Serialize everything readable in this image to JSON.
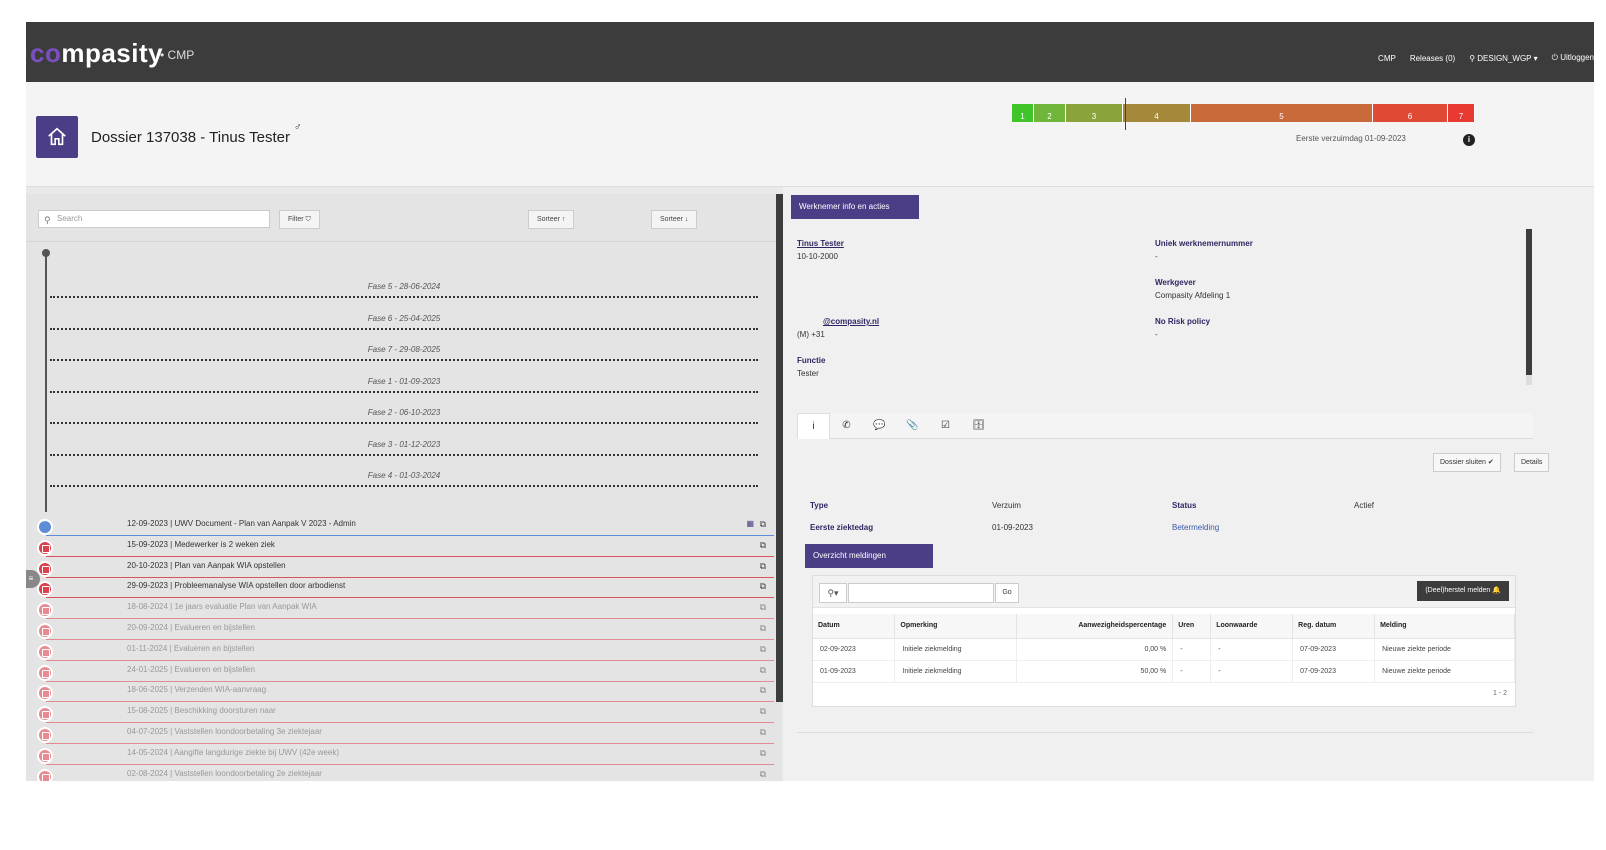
{
  "app": {
    "logo_prefix": "co",
    "logo_rest": "mpasity",
    "logo_sub": "• CMP",
    "nav": {
      "cmp": "CMP",
      "releases": "Releases (0)",
      "user": "DESIGN_WGP",
      "logout": "Uitloggen"
    }
  },
  "header": {
    "title": "Dossier 137038 - Tinus Tester",
    "gender_symbol": "♂",
    "first_absence": "Eerste verzuimdag 01-09-2023",
    "info": "i",
    "phases": [
      {
        "label": "1",
        "color": "#3fc52a"
      },
      {
        "label": "2",
        "color": "#6fb63a"
      },
      {
        "label": "3",
        "color": "#8aa33a"
      },
      {
        "label": "4",
        "color": "#a5893a"
      },
      {
        "label": "5",
        "color": "#c96a3a"
      },
      {
        "label": "6",
        "color": "#e04a34"
      },
      {
        "label": "7",
        "color": "#e83a30"
      }
    ]
  },
  "left": {
    "search_placeholder": "Search",
    "filter_label": "Filter",
    "sort_up_label": "Sorteer ↑",
    "sort_down_label": "Sorteer ↓",
    "phases": [
      "Fase 5 - 28-06-2024",
      "Fase 6 - 25-04-2025",
      "Fase 7 - 29-08-2025",
      "Fase 1 - 01-09-2023",
      "Fase 2 - 06-10-2023",
      "Fase 3 - 01-12-2023",
      "Fase 4 - 01-03-2024"
    ],
    "items": [
      {
        "text": "12-09-2023 | UWV Document - Plan van Aanpak V 2023 - Admin",
        "state": "first"
      },
      {
        "text": "15-09-2023 | Medewerker is 2 weken ziek",
        "state": "active"
      },
      {
        "text": "20-10-2023 | Plan van Aanpak WIA opstellen",
        "state": "active"
      },
      {
        "text": "29-09-2023 | Probleemanalyse WIA opstellen door arbodienst",
        "state": "active"
      },
      {
        "text": "18-08-2024 | 1e jaars evaluatie Plan van Aanpak WIA",
        "state": "faded"
      },
      {
        "text": "20-09-2024 | Evalueren en bijstellen",
        "state": "faded"
      },
      {
        "text": "01-11-2024 | Evalueren en bijstellen",
        "state": "faded"
      },
      {
        "text": "24-01-2025 | Evalueren en bijstellen",
        "state": "faded"
      },
      {
        "text": "18-06-2025 | Verzenden WIA-aanvraag",
        "state": "faded"
      },
      {
        "text": "15-08-2025 | Beschikking doorsturen naar",
        "state": "faded"
      },
      {
        "text": "04-07-2025 | Vaststellen loondoorbetaling 3e ziektejaar",
        "state": "faded"
      },
      {
        "text": "14-05-2024 | Aangifte langdurige ziekte bij UWV (42e week)",
        "state": "faded"
      },
      {
        "text": "02-08-2024 | Vaststellen loondoorbetaling 2e ziektejaar",
        "state": "faded"
      }
    ]
  },
  "right": {
    "tab_label": "Werknemer info en acties",
    "employee": {
      "name": "Tinus Tester",
      "dob": "10-10-2000",
      "email": "@compasity.nl",
      "phone": "(M) +31",
      "function_label": "Functie",
      "function_value": "Tester",
      "unique_label": "Uniek werknemernummer",
      "unique_value": "-",
      "employer_label": "Werkgever",
      "employer_value": "Compasity Afdeling 1",
      "norisk_label": "No Risk policy",
      "norisk_value": "-"
    },
    "icon_tabs": [
      "i",
      "✆",
      "💬",
      "📎",
      "☑",
      "🗄"
    ],
    "close_btn": "Dossier sluiten",
    "details_btn": "Details",
    "type_label": "Type",
    "type_value": "Verzuim",
    "status_label": "Status",
    "status_value": "Actief",
    "first_sick_label": "Eerste ziektedag",
    "first_sick_value": "01-09-2023",
    "better_link": "Betermelding",
    "overview_tab": "Overzicht meldingen",
    "go_label": "Go",
    "herstel_btn": "(Deel)herstel melden",
    "columns": [
      "Datum",
      "Opmerking",
      "Aanwezigheidspercentage",
      "Uren",
      "Loonwaarde",
      "Reg. datum",
      "Melding"
    ],
    "rows": [
      [
        "02-09-2023",
        "Initiele ziekmelding",
        "0,00 %",
        "-",
        "-",
        "07-09-2023",
        "Nieuwe ziekte periode"
      ],
      [
        "01-09-2023",
        "Initiele ziekmelding",
        "50,00 %",
        "-",
        "-",
        "07-09-2023",
        "Nieuwe ziekte periode"
      ]
    ],
    "count": "1 - 2"
  }
}
